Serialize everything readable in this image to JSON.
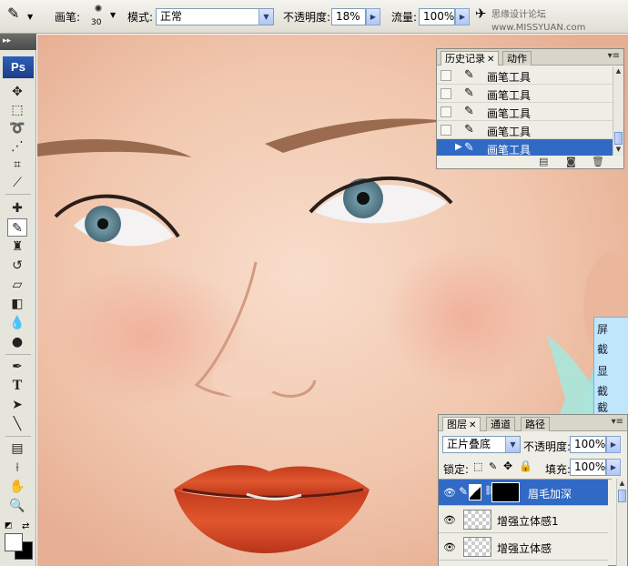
{
  "options_bar": {
    "brush_label": "画笔:",
    "brush_size": "30",
    "mode_label": "模式:",
    "mode_value": "正常",
    "opacity_label": "不透明度:",
    "opacity_value": "18%",
    "flow_label": "流量:",
    "flow_value": "100%",
    "watermark": "思缘设计论坛 www.MISSYUAN.com"
  },
  "tools": {
    "logo": "Ps",
    "grip": "▸▸",
    "type_tool_glyph": "T"
  },
  "history_panel": {
    "tabs": [
      "历史记录",
      "动作"
    ],
    "items": [
      "画笔工具",
      "画笔工具",
      "画笔工具",
      "画笔工具",
      "画笔工具"
    ],
    "selected_index": 4
  },
  "sidebar": {
    "items": [
      "屏",
      "截",
      "显",
      "截",
      "截"
    ]
  },
  "layers_panel": {
    "tabs": [
      "图层",
      "通道",
      "路径"
    ],
    "blend_mode": "正片叠底",
    "opacity_label": "不透明度:",
    "opacity_value": "100%",
    "lock_label": "锁定:",
    "fill_label": "填充:",
    "fill_value": "100%",
    "layers": [
      {
        "name": "眉毛加深",
        "selected": true
      },
      {
        "name": "增强立体感1",
        "selected": false
      },
      {
        "name": "增强立体感",
        "selected": false
      }
    ]
  },
  "colors": {
    "selection": "#316ac5",
    "canvas_bg": "#9fe0d6",
    "lips": "#d2401e"
  }
}
